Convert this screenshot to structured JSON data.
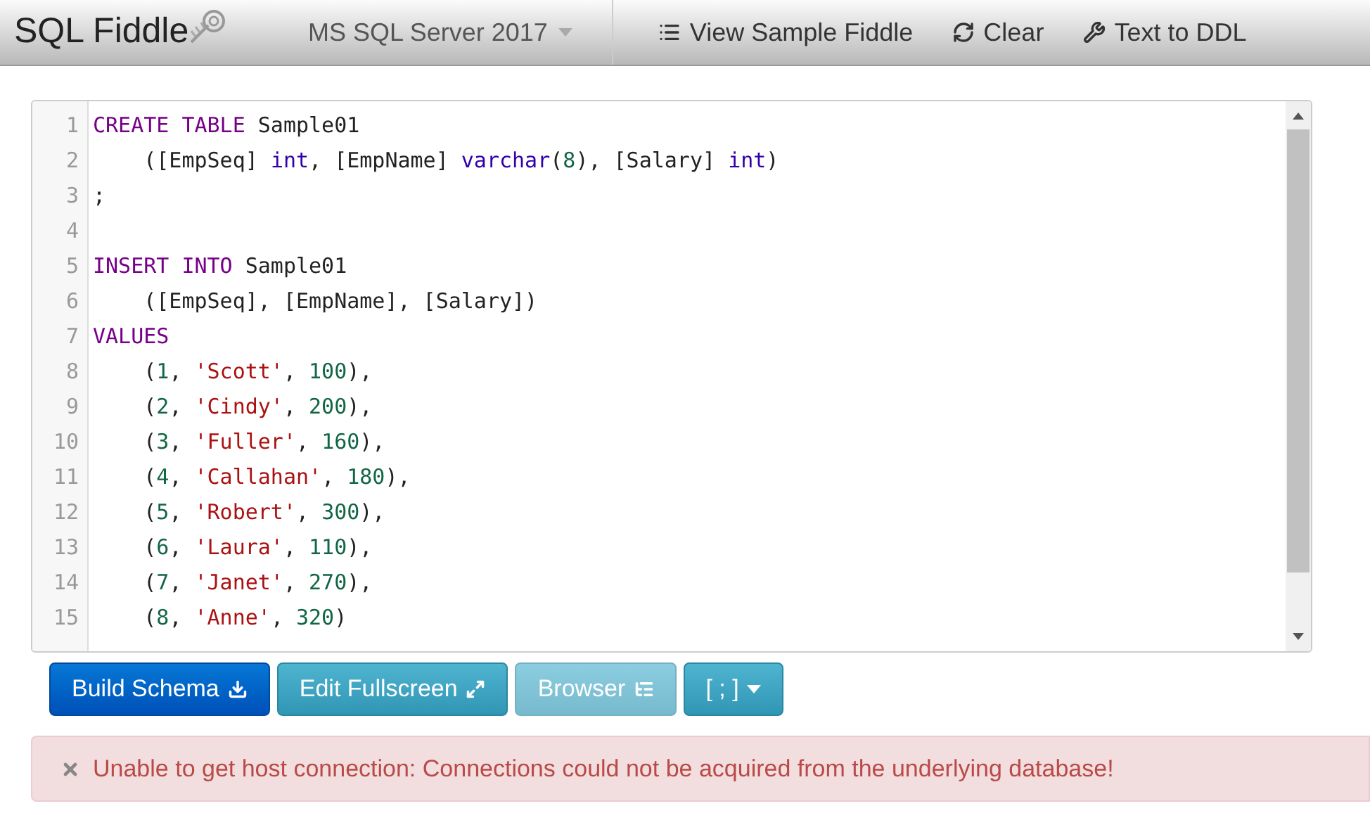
{
  "header": {
    "logo": "SQL Fiddle",
    "database": "MS SQL Server 2017",
    "actions": [
      {
        "label": "View Sample Fiddle"
      },
      {
        "label": "Clear"
      },
      {
        "label": "Text to DDL"
      }
    ]
  },
  "editor": {
    "lines": [
      {
        "number": "1",
        "tokens": [
          {
            "kind": "keyword",
            "text": "CREATE TABLE"
          },
          {
            "kind": "plain",
            "text": " Sample01"
          }
        ]
      },
      {
        "number": "2",
        "tokens": [
          {
            "kind": "plain",
            "text": "    ([EmpSeq] "
          },
          {
            "kind": "type",
            "text": "int"
          },
          {
            "kind": "plain",
            "text": ", [EmpName] "
          },
          {
            "kind": "type",
            "text": "varchar"
          },
          {
            "kind": "plain",
            "text": "("
          },
          {
            "kind": "number",
            "text": "8"
          },
          {
            "kind": "plain",
            "text": "), [Salary] "
          },
          {
            "kind": "type",
            "text": "int"
          },
          {
            "kind": "plain",
            "text": ")"
          }
        ]
      },
      {
        "number": "3",
        "tokens": [
          {
            "kind": "plain",
            "text": ";"
          }
        ]
      },
      {
        "number": "4"
      },
      {
        "number": "5",
        "tokens": [
          {
            "kind": "keyword",
            "text": "INSERT INTO"
          },
          {
            "kind": "plain",
            "text": " Sample01"
          }
        ]
      },
      {
        "number": "6",
        "tokens": [
          {
            "kind": "plain",
            "text": "    ([EmpSeq], [EmpName], [Salary])"
          }
        ]
      },
      {
        "number": "7",
        "tokens": [
          {
            "kind": "keyword",
            "text": "VALUES"
          }
        ]
      },
      {
        "number": "8",
        "tokens": [
          {
            "kind": "plain",
            "text": "    ("
          },
          {
            "kind": "number",
            "text": "1"
          },
          {
            "kind": "plain",
            "text": ", "
          },
          {
            "kind": "string",
            "text": "'Scott'"
          },
          {
            "kind": "plain",
            "text": ", "
          },
          {
            "kind": "number",
            "text": "100"
          },
          {
            "kind": "plain",
            "text": "),"
          }
        ]
      },
      {
        "number": "9",
        "tokens": [
          {
            "kind": "plain",
            "text": "    ("
          },
          {
            "kind": "number",
            "text": "2"
          },
          {
            "kind": "plain",
            "text": ", "
          },
          {
            "kind": "string",
            "text": "'Cindy'"
          },
          {
            "kind": "plain",
            "text": ", "
          },
          {
            "kind": "number",
            "text": "200"
          },
          {
            "kind": "plain",
            "text": "),"
          }
        ]
      },
      {
        "number": "10",
        "tokens": [
          {
            "kind": "plain",
            "text": "    ("
          },
          {
            "kind": "number",
            "text": "3"
          },
          {
            "kind": "plain",
            "text": ", "
          },
          {
            "kind": "string",
            "text": "'Fuller'"
          },
          {
            "kind": "plain",
            "text": ", "
          },
          {
            "kind": "number",
            "text": "160"
          },
          {
            "kind": "plain",
            "text": "),"
          }
        ]
      },
      {
        "number": "11",
        "tokens": [
          {
            "kind": "plain",
            "text": "    ("
          },
          {
            "kind": "number",
            "text": "4"
          },
          {
            "kind": "plain",
            "text": ", "
          },
          {
            "kind": "string",
            "text": "'Callahan'"
          },
          {
            "kind": "plain",
            "text": ", "
          },
          {
            "kind": "number",
            "text": "180"
          },
          {
            "kind": "plain",
            "text": "),"
          }
        ]
      },
      {
        "number": "12",
        "tokens": [
          {
            "kind": "plain",
            "text": "    ("
          },
          {
            "kind": "number",
            "text": "5"
          },
          {
            "kind": "plain",
            "text": ", "
          },
          {
            "kind": "string",
            "text": "'Robert'"
          },
          {
            "kind": "plain",
            "text": ", "
          },
          {
            "kind": "number",
            "text": "300"
          },
          {
            "kind": "plain",
            "text": "),"
          }
        ]
      },
      {
        "number": "13",
        "tokens": [
          {
            "kind": "plain",
            "text": "    ("
          },
          {
            "kind": "number",
            "text": "6"
          },
          {
            "kind": "plain",
            "text": ", "
          },
          {
            "kind": "string",
            "text": "'Laura'"
          },
          {
            "kind": "plain",
            "text": ", "
          },
          {
            "kind": "number",
            "text": "110"
          },
          {
            "kind": "plain",
            "text": "),"
          }
        ]
      },
      {
        "number": "14",
        "tokens": [
          {
            "kind": "plain",
            "text": "    ("
          },
          {
            "kind": "number",
            "text": "7"
          },
          {
            "kind": "plain",
            "text": ", "
          },
          {
            "kind": "string",
            "text": "'Janet'"
          },
          {
            "kind": "plain",
            "text": ", "
          },
          {
            "kind": "number",
            "text": "270"
          },
          {
            "kind": "plain",
            "text": "),"
          }
        ]
      },
      {
        "number": "15",
        "tokens": [
          {
            "kind": "plain",
            "text": "    ("
          },
          {
            "kind": "number",
            "text": "8"
          },
          {
            "kind": "plain",
            "text": ", "
          },
          {
            "kind": "string",
            "text": "'Anne'"
          },
          {
            "kind": "plain",
            "text": ", "
          },
          {
            "kind": "number",
            "text": "320"
          },
          {
            "kind": "plain",
            "text": ")"
          }
        ]
      }
    ]
  },
  "buttons": [
    {
      "kind": "primary",
      "label": "Build Schema",
      "disabled": false
    },
    {
      "kind": "info",
      "label": "Edit Fullscreen",
      "disabled": false
    },
    {
      "kind": "info",
      "label": "Browser",
      "disabled": true
    },
    {
      "kind": "dropdown",
      "label": "[ ; ]",
      "disabled": false
    }
  ],
  "alert": {
    "message": "Unable to get host connection: Connections could not be acquired from the underlying database!"
  }
}
